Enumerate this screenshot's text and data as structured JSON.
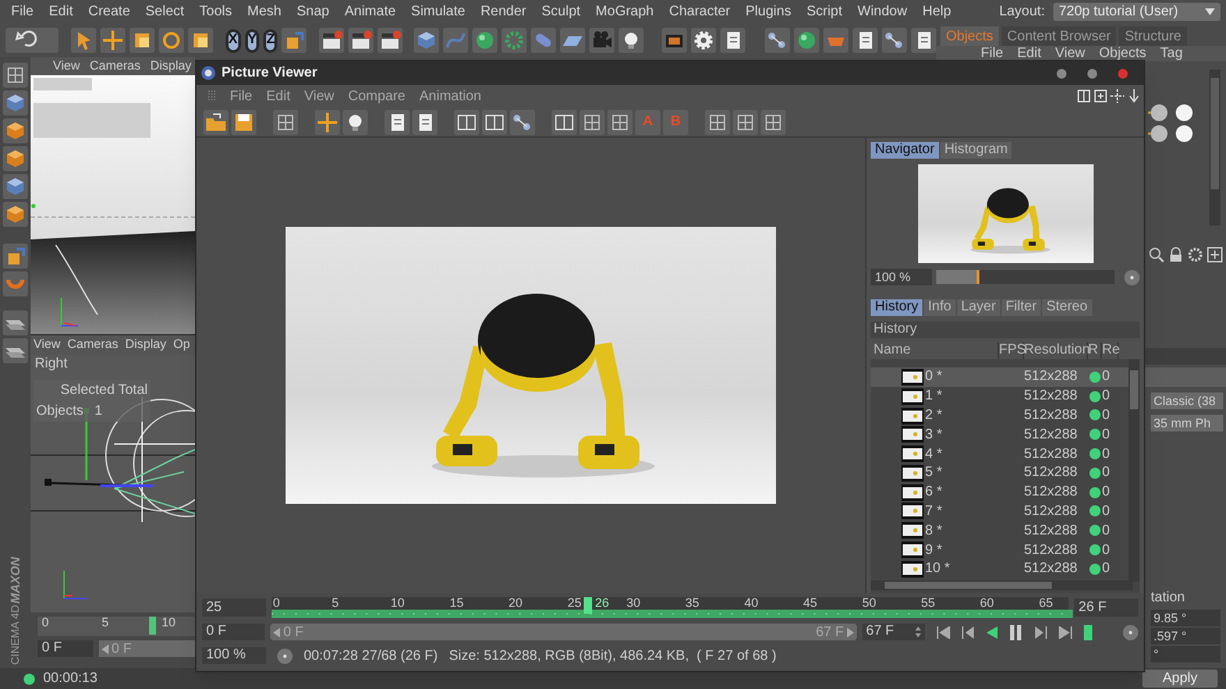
{
  "menu_bar": {
    "items": [
      "File",
      "Edit",
      "Create",
      "Select",
      "Tools",
      "Mesh",
      "Snap",
      "Animate",
      "Simulate",
      "Render",
      "Sculpt",
      "MoGraph",
      "Character",
      "Plugins",
      "Script",
      "Window",
      "Help"
    ]
  },
  "layout_selector": {
    "label": "Layout:",
    "value": "720p tutorial (User)"
  },
  "toolbar": {
    "axis_buttons": [
      "X",
      "Y",
      "Z"
    ]
  },
  "object_manager": {
    "tabs": [
      {
        "label": "Objects",
        "selected": true
      },
      {
        "label": "Content Browser",
        "selected": false
      },
      {
        "label": "Structure",
        "selected": false
      }
    ],
    "menu": [
      "File",
      "Edit",
      "View",
      "Objects",
      "Tag"
    ]
  },
  "attributes": {
    "fields": [
      "Classic (38",
      "35 mm Ph"
    ],
    "section_label": "tation",
    "values": [
      "9.85 °",
      ".597 °",
      "°"
    ],
    "apply_button": "Apply"
  },
  "viewport_top": {
    "menu": [
      "View",
      "Cameras",
      "Display"
    ]
  },
  "viewport_right": {
    "menu": [
      "View",
      "Cameras",
      "Display",
      "Op"
    ],
    "view_name": "Right",
    "stats": {
      "header": "Selected Total",
      "row_label": "Objects",
      "row_value": "1"
    }
  },
  "mini_timeline": {
    "ticks": [
      "0",
      "5",
      "10"
    ],
    "playhead": {
      "level": 0.71
    },
    "frame_field": "0 F",
    "range": {
      "start": "0 F",
      "level": 1
    }
  },
  "status_bar": {
    "time": "00:00:13"
  },
  "logo": {
    "brand": "MAXON",
    "product": "CINEMA 4D"
  },
  "picture_viewer": {
    "title": "Picture Viewer",
    "menu": [
      "File",
      "Edit",
      "View",
      "Compare",
      "Animation"
    ],
    "compare_buttons": [
      "A",
      "B"
    ],
    "panel_tabs": [
      {
        "label": "Navigator",
        "selected": true
      },
      {
        "label": "Histogram",
        "selected": false
      }
    ],
    "navigator": {
      "zoom": "100 %",
      "level": 0.24
    },
    "history_tabs": [
      {
        "label": "History",
        "selected": true
      },
      {
        "label": "Info",
        "selected": false
      },
      {
        "label": "Layer",
        "selected": false
      },
      {
        "label": "Filter",
        "selected": false
      },
      {
        "label": "Stereo",
        "selected": false
      }
    ],
    "history_title": "History",
    "columns": [
      "Name",
      "FPS",
      "Resolution",
      "R",
      "Re"
    ],
    "rows": [
      {
        "name": "0 *",
        "resolution": "512x288",
        "column_5": "0",
        "selected": true
      },
      {
        "name": "1 *",
        "resolution": "512x288",
        "column_5": "0",
        "selected": false
      },
      {
        "name": "2 *",
        "resolution": "512x288",
        "column_5": "0",
        "selected": false
      },
      {
        "name": "3 *",
        "resolution": "512x288",
        "column_5": "0",
        "selected": false
      },
      {
        "name": "4 *",
        "resolution": "512x288",
        "column_5": "0",
        "selected": false
      },
      {
        "name": "5 *",
        "resolution": "512x288",
        "column_5": "0",
        "selected": false
      },
      {
        "name": "6 *",
        "resolution": "512x288",
        "column_5": "0",
        "selected": false
      },
      {
        "name": "7 *",
        "resolution": "512x288",
        "column_5": "0",
        "selected": false
      },
      {
        "name": "8 *",
        "resolution": "512x288",
        "column_5": "0",
        "selected": false
      },
      {
        "name": "9 *",
        "resolution": "512x288",
        "column_5": "0",
        "selected": false
      },
      {
        "name": "10 *",
        "resolution": "512x288",
        "column_5": "0",
        "selected": false
      }
    ],
    "timeline": {
      "fps": "25",
      "ticks": [
        "0",
        "5",
        "10",
        "15",
        "20",
        "25",
        "30",
        "35",
        "40",
        "45",
        "50",
        "55",
        "60",
        "65"
      ],
      "playhead": {
        "label": "26",
        "level": 0.392
      },
      "frame_field": "26 F",
      "start_field": "0 F",
      "range": {
        "start": "0 F",
        "end": "67 F",
        "level": 1
      },
      "end_field": "67 F",
      "zoom": "100 %",
      "time_info": "00:07:28 27/68 (26 F)",
      "image_info": "Size: 512x288, RGB (8Bit), 486.24 KB,  ( F 27 of 68 )"
    }
  }
}
